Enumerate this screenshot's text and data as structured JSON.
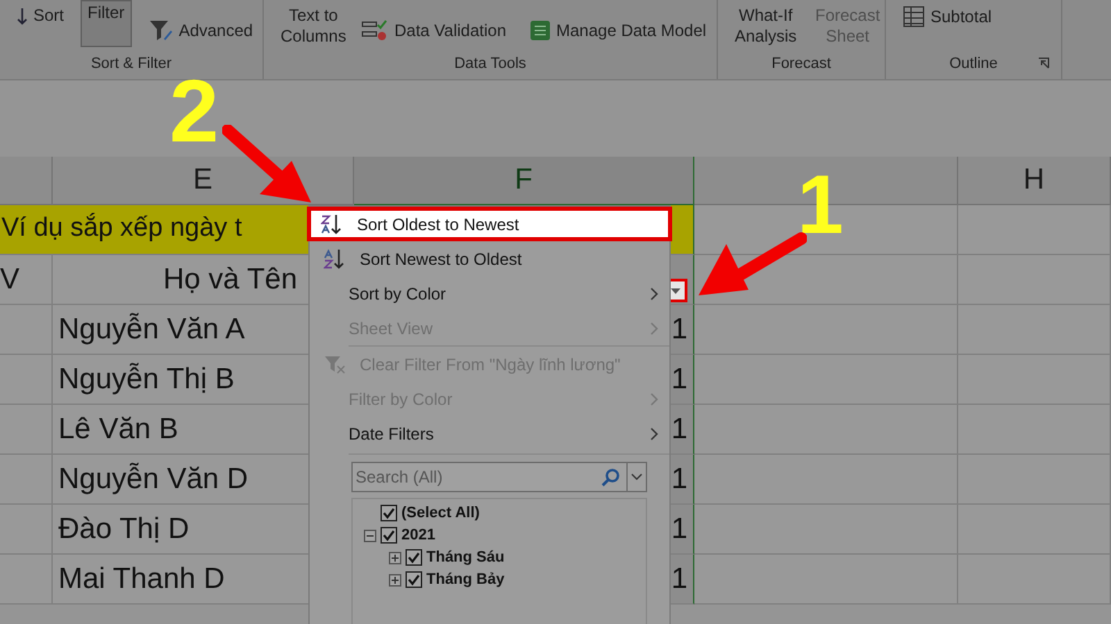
{
  "ribbon": {
    "groups": [
      {
        "label": "Sort & Filter",
        "commands": [
          {
            "label": "Sort",
            "kind": "sort",
            "selected": false,
            "disabled": false
          },
          {
            "label": "Filter",
            "kind": "filter",
            "selected": true,
            "disabled": false
          },
          {
            "label": "Advanced",
            "kind": "advanced",
            "selected": false,
            "disabled": false
          }
        ]
      },
      {
        "label": "Data Tools",
        "commands": [
          {
            "label": "Text to Columns",
            "kind": "text_to_columns",
            "selected": false,
            "disabled": false
          },
          {
            "label": "Data Validation",
            "kind": "validation",
            "selected": false,
            "disabled": false
          },
          {
            "label": "Manage Data Model",
            "kind": "data_model",
            "selected": false,
            "disabled": false
          }
        ]
      },
      {
        "label": "Forecast",
        "commands": [
          {
            "label": "What-If Analysis",
            "kind": "whatif",
            "selected": false,
            "disabled": false
          },
          {
            "label": "Forecast Sheet",
            "kind": "forecast",
            "selected": false,
            "disabled": true
          }
        ]
      },
      {
        "label": "Outline",
        "commands": [
          {
            "label": "Subtotal",
            "kind": "subtotal",
            "selected": false,
            "disabled": false
          }
        ]
      }
    ]
  },
  "sheet": {
    "columns": [
      {
        "selected": false
      },
      {
        "label": "E",
        "selected": false
      },
      {
        "label": "F",
        "selected": true
      },
      {
        "selected": false
      },
      {
        "label": "H",
        "selected": false
      }
    ],
    "title": "Ví dụ sắp xếp ngày t",
    "header_row": {
      "column_d": "V",
      "column_e": "Họ và Tên"
    },
    "rows": [
      {
        "name": "Nguyễn Văn A",
        "column_f": "1"
      },
      {
        "name": "Nguyễn Thị B",
        "column_f": "1"
      },
      {
        "name": "Lê Văn B",
        "column_f": "1"
      },
      {
        "name": "Nguyễn Văn D",
        "column_f": "1"
      },
      {
        "name": "Đào Thị D",
        "column_f": "1"
      },
      {
        "name": "Mai Thanh D",
        "column_f": "1"
      }
    ]
  },
  "filter_menu": {
    "items": [
      {
        "label": "Sort Oldest to Newest",
        "kind": "sort_asc",
        "disabled": false,
        "submenu": false,
        "selected": true
      },
      {
        "label": "Sort Newest to Oldest",
        "kind": "sort_desc",
        "disabled": false,
        "submenu": false,
        "selected": false
      },
      {
        "label": "Sort by Color",
        "kind": "plain",
        "disabled": false,
        "submenu": true,
        "selected": false
      },
      {
        "label": "Sheet View",
        "kind": "plain",
        "disabled": true,
        "submenu": true,
        "selected": false
      },
      {
        "label": "Clear Filter From \"Ngày lĩnh lương\"",
        "kind": "clear",
        "disabled": true,
        "submenu": false,
        "selected": false
      },
      {
        "label": "Filter by Color",
        "kind": "plain",
        "disabled": true,
        "submenu": true,
        "selected": false
      },
      {
        "label": "Date Filters",
        "kind": "plain",
        "disabled": false,
        "submenu": true,
        "selected": false
      }
    ],
    "search": {
      "placeholder": "Search (All)"
    },
    "tree": [
      {
        "label": "(Select All)",
        "checked": true
      },
      {
        "label": "2021",
        "checked": true,
        "expanded": true,
        "children": [
          {
            "label": "Tháng Sáu",
            "checked": true,
            "expanded": false
          },
          {
            "label": "Tháng Bảy",
            "checked": true,
            "expanded": false
          }
        ]
      }
    ]
  },
  "annotations": [
    {
      "label": "2"
    },
    {
      "label": "1"
    }
  ]
}
